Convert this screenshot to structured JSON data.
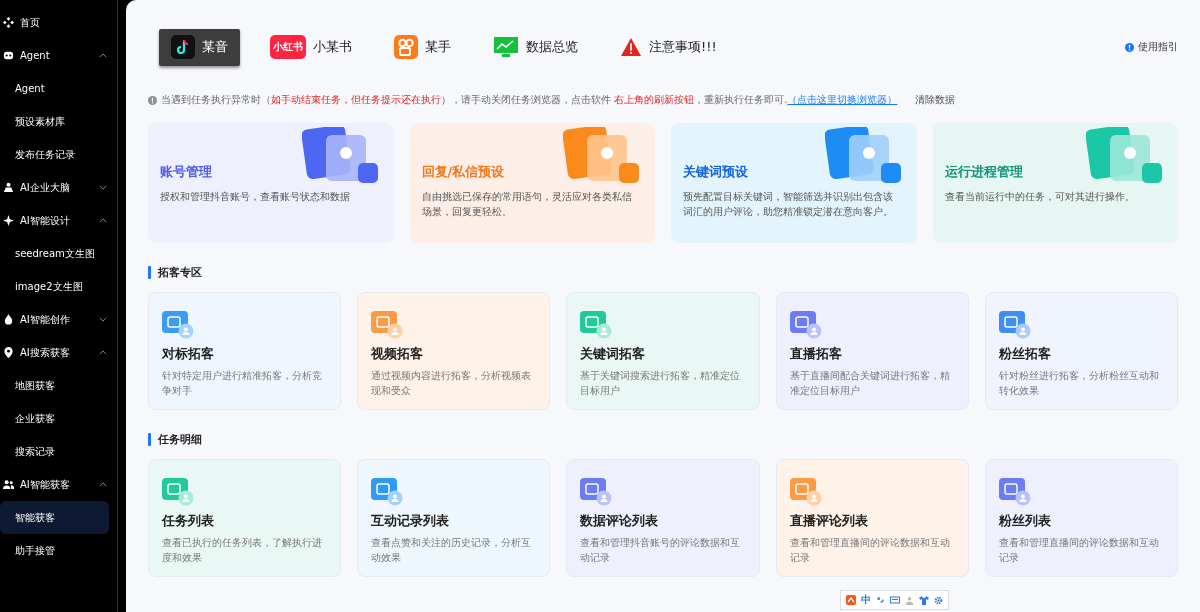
{
  "sidebar": {
    "items": [
      {
        "kind": "link",
        "label": "首页",
        "selected": false
      },
      {
        "kind": "group",
        "label": "Agent",
        "expanded": true,
        "children": [
          {
            "label": "Agent",
            "selected": false
          },
          {
            "label": "预设素材库",
            "selected": false
          },
          {
            "label": "发布任务记录",
            "selected": false
          }
        ]
      },
      {
        "kind": "group",
        "label": "AI企业大脑",
        "expanded": false
      },
      {
        "kind": "group",
        "label": "AI智能设计",
        "expanded": true,
        "children": [
          {
            "label": "seedream文生图",
            "selected": false
          },
          {
            "label": "image2文生图",
            "selected": false
          }
        ]
      },
      {
        "kind": "group",
        "label": "AI智能创作",
        "expanded": false
      },
      {
        "kind": "group",
        "label": "AI搜索获客",
        "expanded": true,
        "children": [
          {
            "label": "地图获客",
            "selected": false
          },
          {
            "label": "企业获客",
            "selected": false
          },
          {
            "label": "搜索记录",
            "selected": false
          }
        ]
      },
      {
        "kind": "group",
        "label": "AI智能获客",
        "expanded": true,
        "children": [
          {
            "label": "智能获客",
            "selected": true
          },
          {
            "label": "助手接管",
            "selected": false
          }
        ]
      }
    ]
  },
  "tabs": [
    {
      "kind": "tiktok",
      "label": "某音",
      "selected": true
    },
    {
      "kind": "redbook",
      "badge": "小红书",
      "label": "小某书",
      "selected": false
    },
    {
      "kind": "kuaishou",
      "label": "某手",
      "selected": false
    },
    {
      "kind": "monitor",
      "label": "数据总览",
      "selected": false
    },
    {
      "kind": "warning",
      "label": "注意事项!!!",
      "selected": false
    }
  ],
  "guide_link": "使用指引",
  "notice": {
    "parts": [
      {
        "kind": "text",
        "text": "当遇到任务执行异常时（"
      },
      {
        "kind": "alert",
        "text": "如手动结束任务，但任务提示还在执行"
      },
      {
        "kind": "text",
        "text": "），请手动关闭任务浏览器，点击软件 "
      },
      {
        "kind": "alert",
        "text": "右上角的刷新按钮"
      },
      {
        "kind": "text",
        "text": "，重新执行任务即可."
      },
      {
        "kind": "link",
        "text": "（点击这里切换浏览器）"
      }
    ],
    "clear_button": "清除数据"
  },
  "feature_cards": [
    {
      "title": "账号管理",
      "description": "授权和管理抖音账号，查看账号状态和数据"
    },
    {
      "title": "回复/私信预设",
      "description": "自由挑选已保存的常用语句，灵活应对各类私信场景，回复更轻松。"
    },
    {
      "title": "关键词预设",
      "description": "预先配置目标关键词，智能筛选并识别出包含该词汇的用户评论，助您精准锁定潜在意向客户。"
    },
    {
      "title": "运行进程管理",
      "description": "查看当前运行中的任务，可对其进行操作。"
    }
  ],
  "sections": [
    {
      "title": "拓客专区",
      "cards": [
        {
          "title": "对标拓客",
          "description": "针对特定用户进行精准拓客，分析竞争对手"
        },
        {
          "title": "视频拓客",
          "description": "通过视频内容进行拓客，分析视频表现和受众"
        },
        {
          "title": "关键词拓客",
          "description": "基于关键词搜索进行拓客，精准定位目标用户"
        },
        {
          "title": "直播拓客",
          "description": "基于直播间配合关键词进行拓客，精准定位目标用户"
        },
        {
          "title": "粉丝拓客",
          "description": "针对粉丝进行拓客，分析粉丝互动和转化效果"
        }
      ]
    },
    {
      "title": "任务明细",
      "cards": [
        {
          "title": "任务列表",
          "description": "查看已执行的任务列表，了解执行进度和效果"
        },
        {
          "title": "互动记录列表",
          "description": "查看点赞和关注的历史记录，分析互动效果"
        },
        {
          "title": "数据评论列表",
          "description": "查看和管理抖音账号的评论数据和互动记录"
        },
        {
          "title": "直播评论列表",
          "description": "查看和管理直播间的评论数据和互动记录"
        },
        {
          "title": "粉丝列表",
          "description": "查看和管理直播间的评论数据和互动记录"
        }
      ]
    }
  ],
  "ime_toolbar": {
    "mode": "中"
  }
}
